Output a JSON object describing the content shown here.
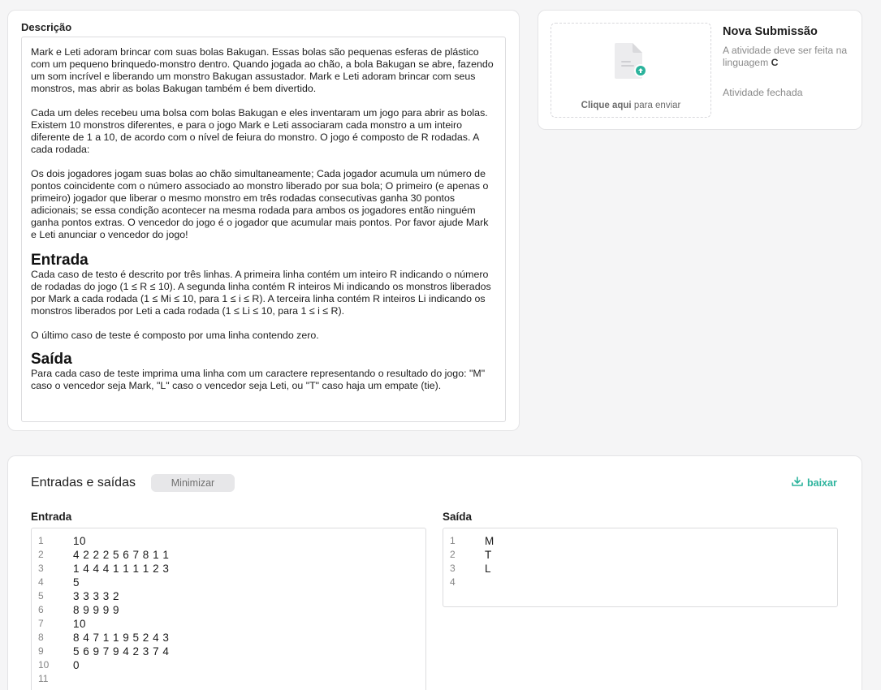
{
  "description": {
    "title": "Descrição",
    "paragraphs": [
      "Mark e Leti adoram brincar com suas bolas Bakugan. Essas bolas são pequenas esferas de plástico com um pequeno brinquedo-monstro dentro. Quando jogada ao chão, a bola Bakugan se abre, fazendo um som incrível e liberando um monstro Bakugan assustador. Mark e Leti adoram brincar com seus monstros, mas abrir as bolas Bakugan também é bem divertido.",
      "Cada um deles recebeu uma bolsa com bolas Bakugan e eles inventaram um jogo para abrir as bolas. Existem 10 monstros diferentes, e para o jogo Mark e Leti associaram cada monstro a um inteiro diferente de 1 a 10, de acordo com o nível de feiura do monstro. O jogo é composto de R rodadas. A cada rodada:",
      "Os dois jogadores jogam suas bolas ao chão simultaneamente; Cada jogador acumula um número de pontos coincidente com o número associado ao monstro liberado por sua bola; O primeiro (e apenas o primeiro) jogador que liberar o mesmo monstro em três rodadas consecutivas ganha 30 pontos adicionais; se essa condição acontecer na mesma rodada para ambos os jogadores então ninguém ganha pontos extras. O vencedor do jogo é o jogador que acumular mais pontos. Por favor ajude Mark e Leti anunciar o vencedor do jogo!"
    ],
    "input_heading": "Entrada",
    "input_paragraphs": [
      "Cada caso de testo é descrito por três linhas. A primeira linha contém um inteiro R indicando o número de rodadas do jogo (1 ≤ R ≤ 10). A segunda linha contém R inteiros Mi indicando os monstros liberados por Mark a cada rodada (1 ≤ Mi ≤ 10, para 1 ≤ i ≤ R). A terceira linha contém R inteiros Li indicando os monstros liberados por Leti a cada rodada (1 ≤ Li ≤ 10, para 1 ≤ i ≤ R).",
      "O último caso de teste é composto por uma linha contendo zero."
    ],
    "output_heading": "Saída",
    "output_paragraphs": [
      "Para cada caso de teste imprima uma linha com um caractere representando o resultado do jogo: \"M\" caso o vencedor seja Mark, \"L\" caso o vencedor seja Leti, ou \"T\" caso haja um empate (tie)."
    ]
  },
  "submission": {
    "upload_label_bold": "Clique aqui",
    "upload_label_rest": " para enviar",
    "title": "Nova Submissão",
    "note_prefix": "A atividade deve ser feita na linguagem ",
    "note_language": "C",
    "status": "Atividade fechada",
    "accent_color": "#2bb39c"
  },
  "io": {
    "title": "Entradas e saídas",
    "minimize_label": "Minimizar",
    "download_label": "baixar",
    "input_label": "Entrada",
    "output_label": "Saída",
    "input_lines": [
      "10",
      "4 2 2 2 5 6 7 8 1 1",
      "1 4 4 4 1 1 1 1 2 3",
      "5",
      "3 3 3 3 2",
      "8 9 9 9 9",
      "10",
      "8 4 7 1 1 9 5 2 4 3",
      "5 6 9 7 9 4 2 3 7 4",
      "0",
      ""
    ],
    "output_lines": [
      "M",
      "T",
      "L",
      ""
    ]
  }
}
